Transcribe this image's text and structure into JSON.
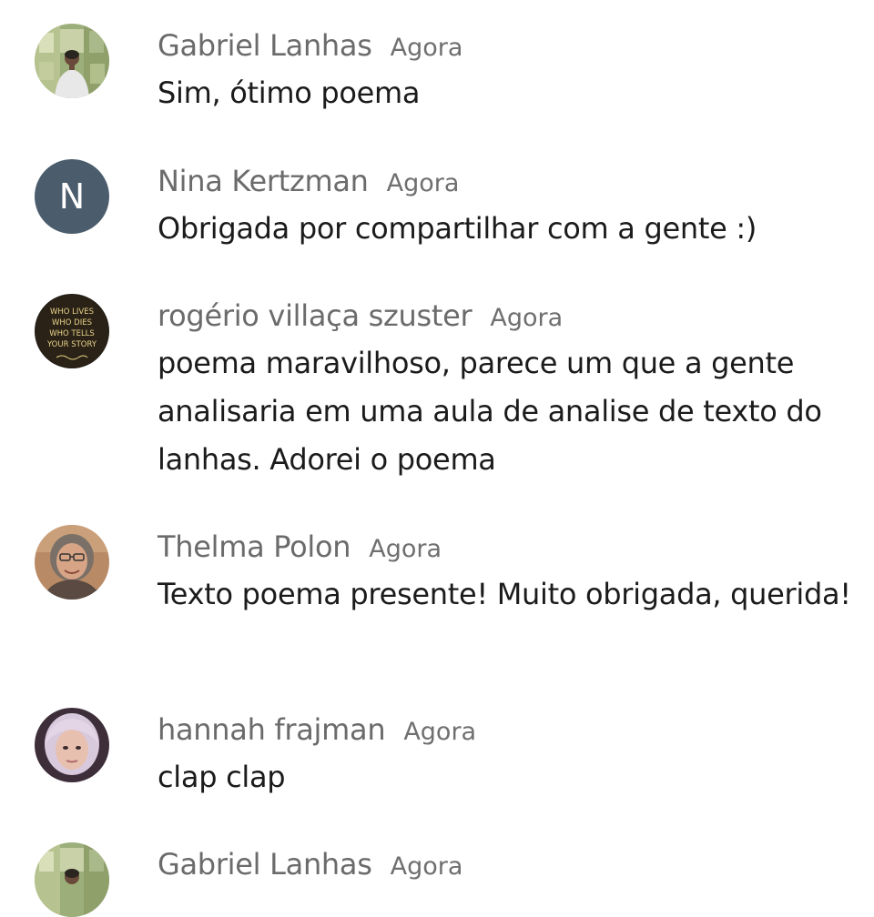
{
  "comments": [
    {
      "author": "Gabriel Lanhas",
      "time": "Agora",
      "text": "Sim, ótimo poema",
      "avatar": "photo-man-green-wall"
    },
    {
      "author": "Nina Kertzman",
      "time": "Agora",
      "text": "Obrigada por compartilhar com a gente :)",
      "avatar_letter": "N",
      "avatar_color": "#4b5d6d"
    },
    {
      "author": "rogério villaça szuster",
      "time": "Agora",
      "text": "poema maravilhoso, parece um que a gente analisaria em uma aula de analise de texto do lanhas. Adorei o poema",
      "avatar_text": [
        "WHO LIVES",
        "WHO DIES",
        "WHO TELLS",
        "YOUR STORY"
      ]
    },
    {
      "author": "Thelma Polon",
      "time": "Agora",
      "text": "Texto poema presente! Muito obrigada, querida!",
      "avatar": "photo-woman-glasses"
    },
    {
      "author": "hannah frajman",
      "time": "Agora",
      "text": "clap clap",
      "avatar": "photo-woman-light-hair"
    },
    {
      "author": "Gabriel Lanhas",
      "time": "Agora",
      "text": "",
      "avatar": "photo-man-green-wall"
    }
  ]
}
